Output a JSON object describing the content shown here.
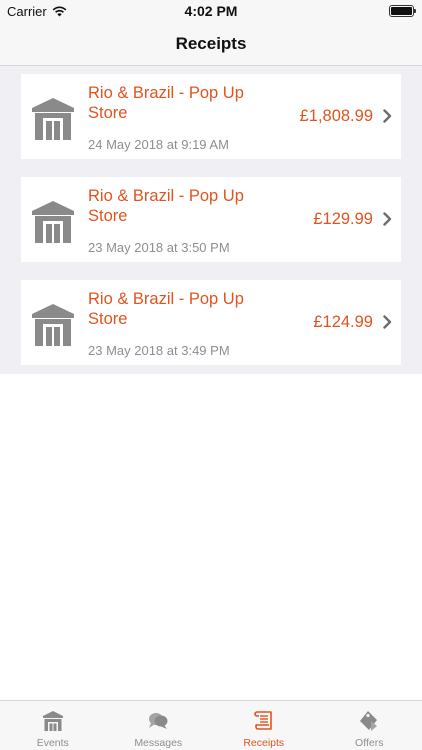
{
  "status_bar": {
    "carrier": "Carrier",
    "time": "4:02 PM"
  },
  "nav": {
    "title": "Receipts"
  },
  "receipts": [
    {
      "store": "Rio & Brazil - Pop Up Store",
      "amount": "£1,808.99",
      "date": "24 May 2018 at 9:19 AM"
    },
    {
      "store": "Rio & Brazil - Pop Up Store",
      "amount": "£129.99",
      "date": "23 May 2018 at 3:50 PM"
    },
    {
      "store": "Rio & Brazil - Pop Up Store",
      "amount": "£124.99",
      "date": "23 May 2018 at 3:49 PM"
    }
  ],
  "tabs": [
    {
      "label": "Events",
      "icon": "store-icon",
      "active": false
    },
    {
      "label": "Messages",
      "icon": "chat-bubbles-icon",
      "active": false
    },
    {
      "label": "Receipts",
      "icon": "receipt-scroll-icon",
      "active": true
    },
    {
      "label": "Offers",
      "icon": "offers-tag-icon",
      "active": false
    }
  ],
  "colors": {
    "accent": "#e0541f",
    "icon_gray": "#8a8a8a",
    "secondary_text": "#8e8e93",
    "list_background": "#efeff4"
  }
}
